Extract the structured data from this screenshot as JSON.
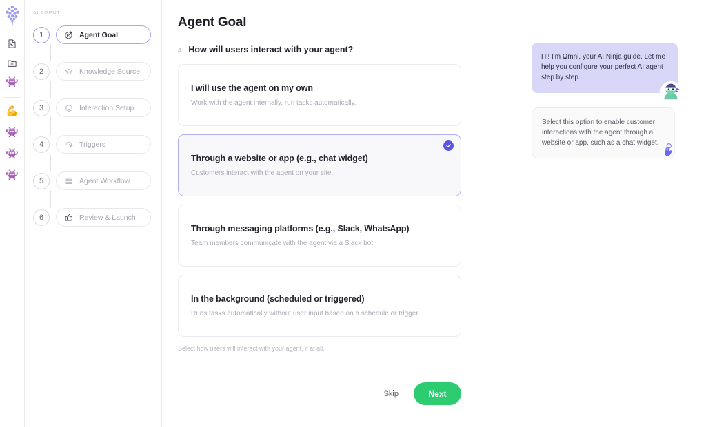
{
  "rail": {
    "logo_icon": "grape-cluster-logo",
    "items": [
      {
        "icon": "page-fold-icon",
        "name": "rail-item-pages"
      },
      {
        "icon": "folder-plus-icon",
        "name": "rail-item-new-folder"
      },
      {
        "icon": "robot-face-icon",
        "name": "rail-item-agent-1",
        "glyph": "👾"
      },
      {
        "icon": "flexed-bicep-icon",
        "name": "rail-item-strength",
        "glyph": "💪"
      },
      {
        "icon": "robot-face-icon",
        "name": "rail-item-agent-2",
        "glyph": "👾"
      },
      {
        "icon": "robot-face-icon",
        "name": "rail-item-agent-3",
        "glyph": "👾"
      },
      {
        "icon": "robot-face-icon",
        "name": "rail-item-agent-4",
        "glyph": "👾"
      }
    ]
  },
  "sidebar": {
    "label": "AI AGENT",
    "steps": [
      {
        "number": "1",
        "label": "Agent Goal",
        "icon": "target-dart-icon",
        "active": true
      },
      {
        "number": "2",
        "label": "Knowledge Source",
        "icon": "graduation-cap-icon",
        "active": false
      },
      {
        "number": "3",
        "label": "Interaction Setup",
        "icon": "gear-icon",
        "active": false
      },
      {
        "number": "4",
        "label": "Triggers",
        "icon": "cursor-click-icon",
        "active": false
      },
      {
        "number": "5",
        "label": "Agent Workflow",
        "icon": "stacked-lines-icon",
        "active": false
      },
      {
        "number": "6",
        "label": "Review & Launch",
        "icon": "thumbs-up-icon",
        "active": false
      }
    ]
  },
  "main": {
    "title": "Agent Goal",
    "question_number": "4.",
    "question": "How will users interact with your agent?",
    "options": [
      {
        "title": "I will use the agent on my own",
        "subtitle": "Work with the agent internally, run tasks automatically.",
        "selected": false
      },
      {
        "title": "Through a website or app (e.g., chat widget)",
        "subtitle": "Customers interact with the agent on your site.",
        "selected": true
      },
      {
        "title": "Through messaging platforms (e.g., Slack, WhatsApp)",
        "subtitle": "Team members communicate with the agent via a Slack bot.",
        "selected": false
      },
      {
        "title": "In the background (scheduled or triggered)",
        "subtitle": "Runs tasks automatically without user input based on a schedule or trigger.",
        "selected": false
      }
    ],
    "helper_text": "Select how users will interact with your agent, if at all.",
    "skip_label": "Skip",
    "next_label": "Next"
  },
  "chat": {
    "assistant_message": "Hi! I'm Ωmni, your AI Ninja guide. Let me help you configure your perfect AI agent step by step.",
    "hint_message": "Select this option to enable customer interactions with the agent through a website or app, such as a chat widget.",
    "avatar_icon": "ninja-avatar",
    "cursor_icon": "pointing-hand-cursor"
  },
  "colors": {
    "accent_purple": "#5b55e4",
    "bubble_purple": "#d9d7f8",
    "next_green": "#2ecc71",
    "selected_border": "#b3b0f2"
  }
}
